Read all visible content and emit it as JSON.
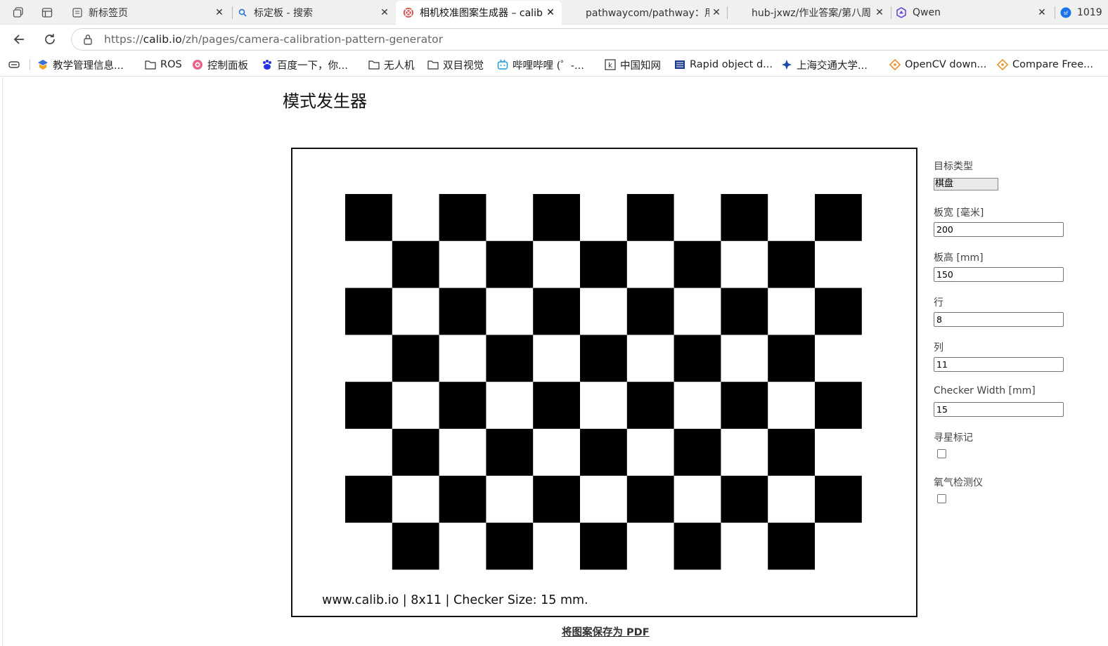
{
  "tabs": [
    {
      "title": "新标签页",
      "icon": "new-tab-icon"
    },
    {
      "title": "标定板 - 搜索",
      "icon": "search-icon"
    },
    {
      "title": "相机校准图案生成器 – calib.io",
      "icon": "calib-icon",
      "active": true
    },
    {
      "title": "pathwaycom/pathway：用",
      "icon": "github-icon"
    },
    {
      "title": "hub-jxwz/作业答案/第八周",
      "icon": "github-icon"
    },
    {
      "title": "Qwen",
      "icon": "qwen-icon"
    },
    {
      "title": "1019",
      "icon": "profile-icon"
    }
  ],
  "address": {
    "scheme": "https://",
    "host": "calib.io",
    "path": "/zh/pages/camera-calibration-pattern-generator"
  },
  "bookmarks": [
    {
      "label": "教学管理信息...",
      "icon": "edu-icon"
    },
    {
      "label": "ROS",
      "icon": "folder-icon"
    },
    {
      "label": "控制面板",
      "icon": "panel-icon"
    },
    {
      "label": "百度一下，你...",
      "icon": "baidu-icon"
    },
    {
      "label": "无人机",
      "icon": "folder-icon"
    },
    {
      "label": "双目视觉",
      "icon": "folder-icon"
    },
    {
      "label": "哔哩哔哩 (゜-...",
      "icon": "bilibili-icon"
    },
    {
      "label": "中国知网",
      "icon": "cnki-icon"
    },
    {
      "label": "Rapid object d...",
      "icon": "ieee-icon"
    },
    {
      "label": "上海交通大学...",
      "icon": "sjtu-icon"
    },
    {
      "label": "OpenCV down...",
      "icon": "opencv-icon"
    },
    {
      "label": "Compare Free...",
      "icon": "compare-icon"
    }
  ],
  "page": {
    "title": "模式发生器",
    "pattern": {
      "rows": 8,
      "cols": 11,
      "caption": "www.calib.io | 8x11 | Checker Size: 15 mm."
    },
    "save_link": "将图案保存为 PDF"
  },
  "form": {
    "target_type_label": "目标类型",
    "target_type_value": "棋盘",
    "board_width_label": "板宽 [毫米]",
    "board_width_value": "200",
    "board_height_label": "板高 [mm]",
    "board_height_value": "150",
    "rows_label": "行",
    "rows_value": "8",
    "cols_label": "列",
    "cols_value": "11",
    "checker_width_label": "Checker Width [mm]",
    "checker_width_value": "15",
    "star_marker_label": "寻星标记",
    "star_marker_checked": false,
    "oxygen_label": "氧气检测仪",
    "oxygen_checked": false
  }
}
